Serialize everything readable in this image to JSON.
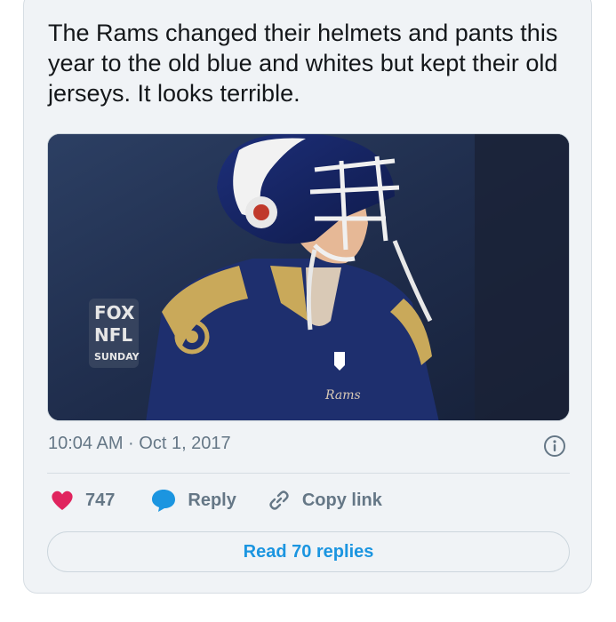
{
  "tweet": {
    "text": "The Rams changed their helmets and pants this year to the old blue and whites but kept their old jerseys. It looks terrible.",
    "timestamp": "10:04 AM · Oct 1, 2017"
  },
  "media": {
    "broadcast_logo_line1": "FOX",
    "broadcast_logo_line2": "NFL",
    "broadcast_logo_line3": "SUNDAY",
    "jersey_wordmark": "Rams"
  },
  "actions": {
    "like_count": "747",
    "reply_label": "Reply",
    "copy_link_label": "Copy link"
  },
  "read_replies_label": "Read 70 replies",
  "colors": {
    "like": "#e0245e",
    "reply": "#1b95e0",
    "link_text": "#1b95e0",
    "muted": "#657786",
    "card_bg": "#f0f3f6"
  }
}
